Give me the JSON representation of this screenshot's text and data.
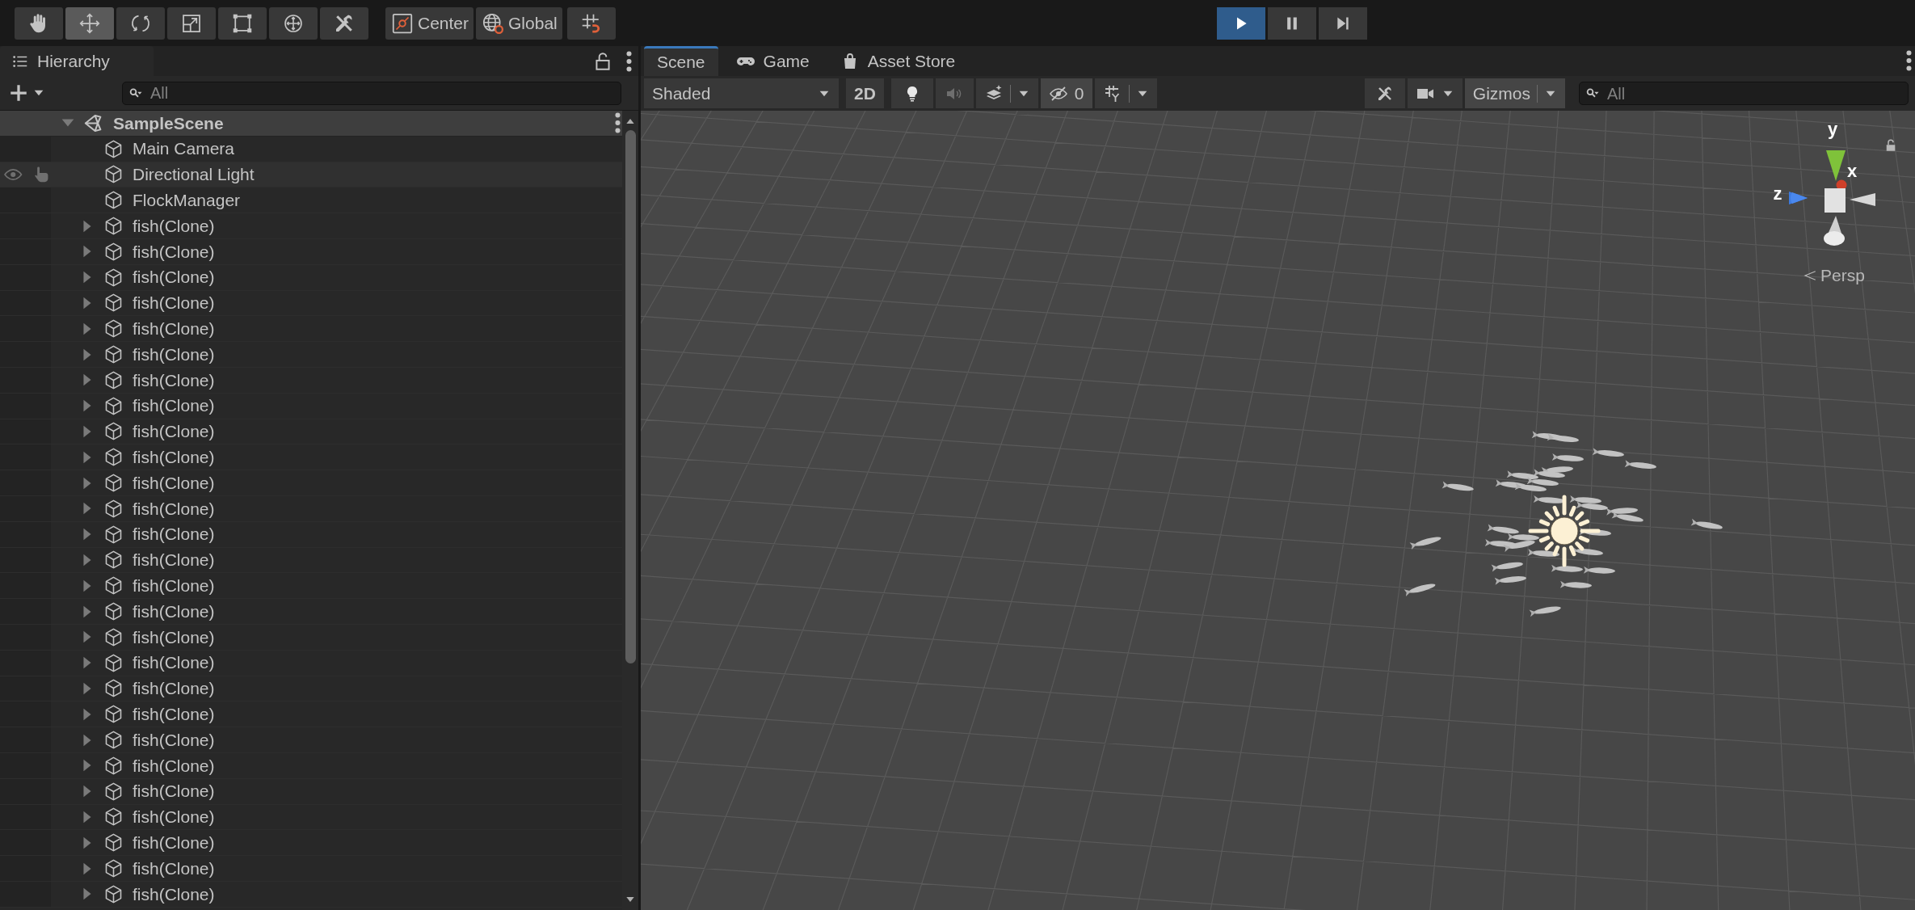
{
  "toolbar": {
    "tools": [
      {
        "kind": "hand",
        "selected": false
      },
      {
        "kind": "move",
        "selected": true
      },
      {
        "kind": "rotate",
        "selected": false
      },
      {
        "kind": "scale",
        "selected": false
      },
      {
        "kind": "rect",
        "selected": false
      },
      {
        "kind": "transform",
        "selected": false
      },
      {
        "kind": "custom",
        "selected": false
      }
    ],
    "handles": [
      {
        "kind": "pivot",
        "label": "Center"
      },
      {
        "kind": "space",
        "label": "Global"
      }
    ],
    "playback": [
      {
        "kind": "play",
        "on": true
      },
      {
        "kind": "pause",
        "on": false
      },
      {
        "kind": "step",
        "on": false
      }
    ]
  },
  "hierarchy": {
    "tab": "Hierarchy",
    "search": {
      "placeholder": "All"
    },
    "scene": {
      "name": "SampleScene",
      "expanded": true,
      "children": [
        {
          "name": "Main Camera",
          "highlighted": false
        },
        {
          "name": "Directional Light",
          "highlighted": true
        },
        {
          "name": "FlockManager",
          "highlighted": false
        },
        {
          "name": "fish(Clone)",
          "highlighted": false,
          "expanded": false
        },
        {
          "name": "fish(Clone)",
          "highlighted": false,
          "expanded": false
        },
        {
          "name": "fish(Clone)",
          "highlighted": false,
          "expanded": false
        },
        {
          "name": "fish(Clone)",
          "highlighted": false,
          "expanded": false
        },
        {
          "name": "fish(Clone)",
          "highlighted": false,
          "expanded": false
        },
        {
          "name": "fish(Clone)",
          "highlighted": false,
          "expanded": false
        },
        {
          "name": "fish(Clone)",
          "highlighted": false,
          "expanded": false
        },
        {
          "name": "fish(Clone)",
          "highlighted": false,
          "expanded": false
        },
        {
          "name": "fish(Clone)",
          "highlighted": false,
          "expanded": false
        },
        {
          "name": "fish(Clone)",
          "highlighted": false,
          "expanded": false
        },
        {
          "name": "fish(Clone)",
          "highlighted": false,
          "expanded": false
        },
        {
          "name": "fish(Clone)",
          "highlighted": false,
          "expanded": false
        },
        {
          "name": "fish(Clone)",
          "highlighted": false,
          "expanded": false
        },
        {
          "name": "fish(Clone)",
          "highlighted": false,
          "expanded": false
        },
        {
          "name": "fish(Clone)",
          "highlighted": false,
          "expanded": false
        },
        {
          "name": "fish(Clone)",
          "highlighted": false,
          "expanded": false
        },
        {
          "name": "fish(Clone)",
          "highlighted": false,
          "expanded": false
        },
        {
          "name": "fish(Clone)",
          "highlighted": false,
          "expanded": false
        },
        {
          "name": "fish(Clone)",
          "highlighted": false,
          "expanded": false
        },
        {
          "name": "fish(Clone)",
          "highlighted": false,
          "expanded": false
        },
        {
          "name": "fish(Clone)",
          "highlighted": false,
          "expanded": false
        },
        {
          "name": "fish(Clone)",
          "highlighted": false,
          "expanded": false
        },
        {
          "name": "fish(Clone)",
          "highlighted": false,
          "expanded": false
        },
        {
          "name": "fish(Clone)",
          "highlighted": false,
          "expanded": false
        },
        {
          "name": "fish(Clone)",
          "highlighted": false,
          "expanded": false
        },
        {
          "name": "fish(Clone)",
          "highlighted": false,
          "expanded": false
        },
        {
          "name": "fish(Clone)",
          "highlighted": false,
          "expanded": false
        }
      ]
    }
  },
  "scene_view": {
    "tabs": [
      {
        "kind": "scene",
        "label": "Scene",
        "selected": true
      },
      {
        "kind": "game",
        "label": "Game",
        "selected": false
      },
      {
        "kind": "store",
        "label": "Asset Store",
        "selected": false
      }
    ],
    "toolbar": {
      "draw_mode": "Shaded",
      "mode_2d": {
        "label": "2D",
        "on": false
      },
      "lighting_on": true,
      "audio_on": false,
      "hidden_count": "0",
      "gizmos": "Gizmos",
      "search": {
        "placeholder": "All"
      }
    },
    "gizmo": {
      "axes": [
        "y",
        "x",
        "z"
      ],
      "projection": "Persp"
    }
  }
}
